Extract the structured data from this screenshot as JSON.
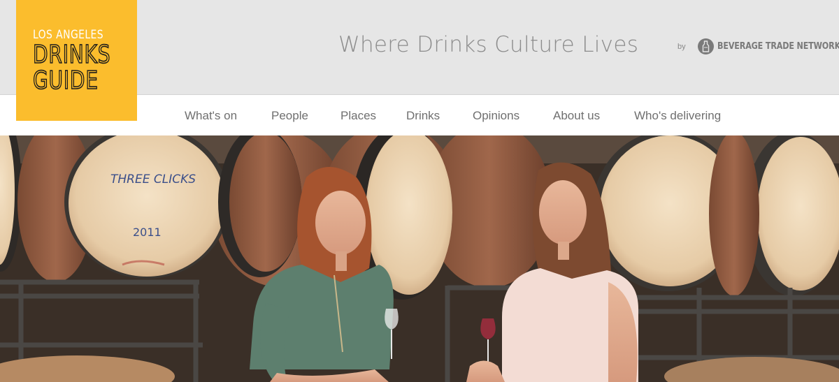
{
  "brand": {
    "logo_line1": "LOS ANGELES",
    "logo_line2": "DRINKS",
    "logo_line3": "GUIDE",
    "color_yellow": "#fbbd2d"
  },
  "header": {
    "tagline": "Where Drinks Culture Lives",
    "by_label": "by",
    "partner": "BEVERAGE TRADE NETWORK",
    "partner_icon": "bottle-circle-icon"
  },
  "nav": {
    "items": [
      {
        "label": "What's on"
      },
      {
        "label": "People"
      },
      {
        "label": "Places"
      },
      {
        "label": "Drinks"
      },
      {
        "label": "Opinions"
      },
      {
        "label": "About us"
      },
      {
        "label": "Who's delivering"
      }
    ]
  },
  "hero": {
    "barrel_text_1": "THREE CLICKS",
    "barrel_text_2": "2011"
  }
}
